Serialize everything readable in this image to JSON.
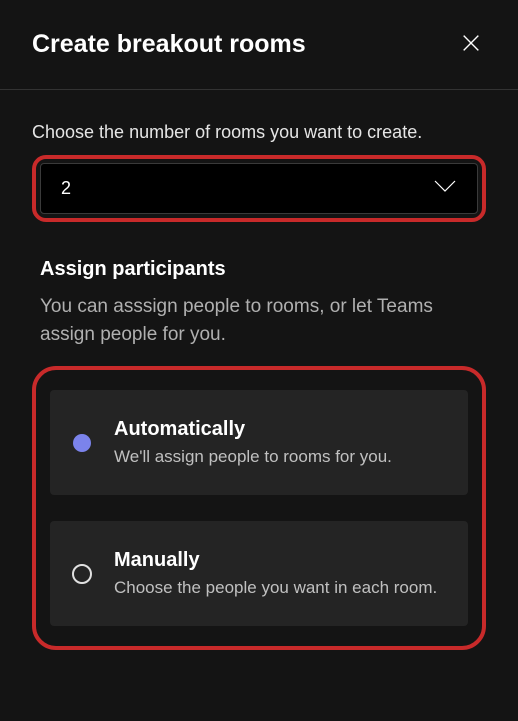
{
  "header": {
    "title": "Create breakout rooms"
  },
  "roomCount": {
    "prompt": "Choose the number of rooms you want to create.",
    "value": "2"
  },
  "assign": {
    "title": "Assign participants",
    "description": "You can asssign people to rooms, or let Teams assign people for you.",
    "options": {
      "automatic": {
        "title": "Automatically",
        "description": "We'll assign people to rooms for you."
      },
      "manual": {
        "title": "Manually",
        "description": "Choose the people you want in each room."
      }
    }
  }
}
